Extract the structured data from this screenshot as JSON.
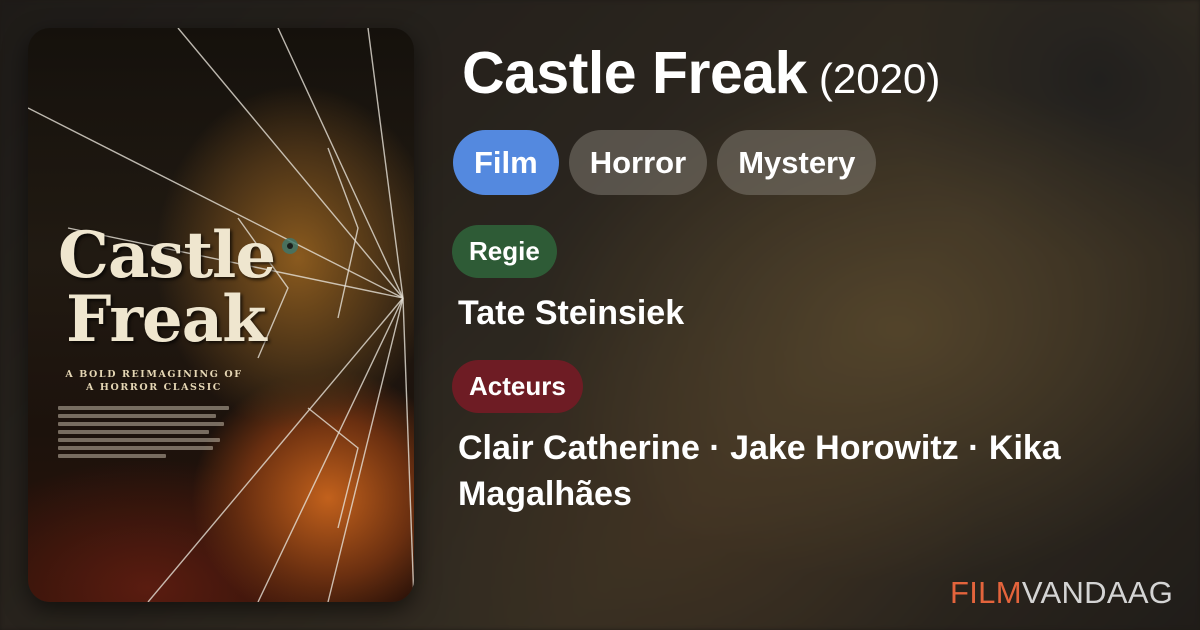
{
  "movie": {
    "title": "Castle Freak",
    "year": "(2020)"
  },
  "poster": {
    "title_line1": "Castle",
    "title_line2": "Freak",
    "tagline": "A BOLD REIMAGINING OF A HORROR CLASSIC"
  },
  "tags": [
    {
      "label": "Film",
      "color": "#5489df"
    },
    {
      "label": "Horror"
    },
    {
      "label": "Mystery"
    }
  ],
  "director": {
    "label": "Regie",
    "label_color": "#2e5b36",
    "name": "Tate Steinsiek"
  },
  "cast": {
    "label": "Acteurs",
    "label_color": "#6e1c24",
    "names": "Clair Catherine · Jake Horowitz · Kika Magalhães"
  },
  "brand": {
    "part1": "FILM",
    "part2": "VANDAAG",
    "accent": "#e4643c"
  }
}
